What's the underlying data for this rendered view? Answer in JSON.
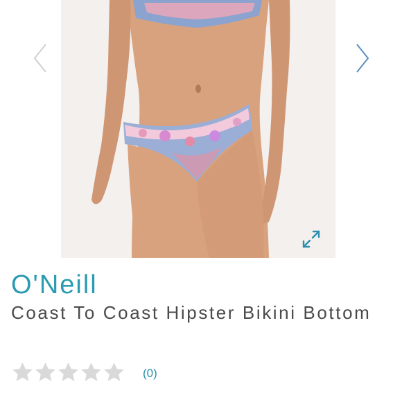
{
  "product": {
    "brand": "O'Neill",
    "title": "Coast To Coast Hipster Bikini Bottom",
    "review_count": "(0)",
    "rating": 0,
    "rating_max": 5
  },
  "gallery": {
    "prev_icon": "chevron-left-icon",
    "next_icon": "chevron-right-icon",
    "expand_icon": "expand-icon"
  },
  "colors": {
    "brand": "#2a9bb0",
    "title": "#4a4a4a",
    "link": "#2a8fb0",
    "star_empty": "#d9d9d9",
    "arrow_prev": "#d0d0d0",
    "arrow_next": "#5a8fbf"
  }
}
